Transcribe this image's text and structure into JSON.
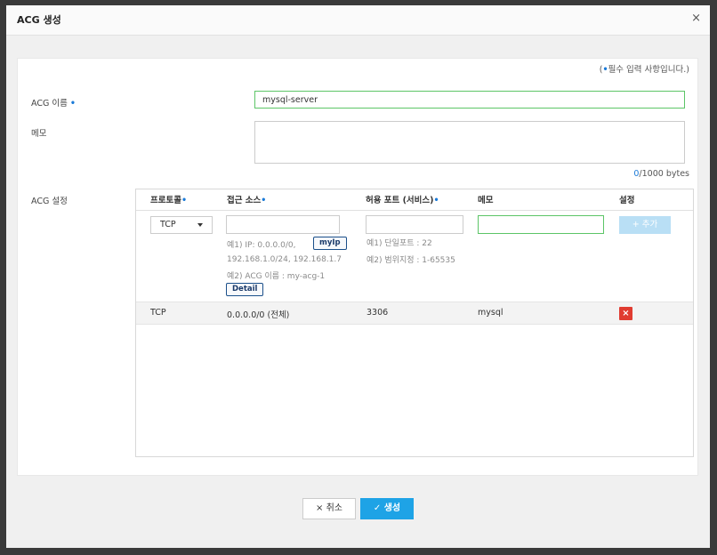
{
  "dialog": {
    "title": "ACG 생성",
    "close_icon": "×"
  },
  "form": {
    "required_note_prefix": "(",
    "required_note_dot": "•",
    "required_note_text": "필수 입력 사항입니다.)",
    "name_label": "ACG 이름",
    "name_value": "mysql-server",
    "memo_label": "메모",
    "memo_value": "",
    "byte_count": "0",
    "byte_limit": "/1000 bytes",
    "acg_label": "ACG 설정",
    "required_dot": "•"
  },
  "table": {
    "headers": {
      "protocol": "프로토콜",
      "source": "접근 소스",
      "port": "허용 포트 (서비스)",
      "memo": "메모",
      "settings": "설정"
    },
    "new_rule": {
      "protocol_selected": "TCP",
      "source_value": "",
      "port_value": "",
      "memo_value": "",
      "source_hint_1": "예1) IP: 0.0.0.0/0,",
      "source_hint_2": "192.168.1.0/24, 192.168.1.7",
      "source_hint_3": "예2) ACG 이름 : my-acg-1",
      "myip_label": "myIp",
      "detail_label": "Detail",
      "port_hint_1": "예1) 단일포트 : 22",
      "port_hint_2": "예2) 범위지정 : 1-65535",
      "add_label": "+ 추가"
    },
    "rows": [
      {
        "protocol": "TCP",
        "source": "0.0.0.0/0 (전체)",
        "port": "3306",
        "memo": "mysql",
        "delete_icon": "×"
      }
    ]
  },
  "footer": {
    "cancel_label": "× 취소",
    "create_label": "✓ 생성"
  },
  "colors": {
    "accent": "#1ea3e6",
    "required_dot": "#1a7ad8",
    "input_focus_border": "#5cc567",
    "delete": "#e03c31",
    "add_disabled": "#b9dff5"
  }
}
